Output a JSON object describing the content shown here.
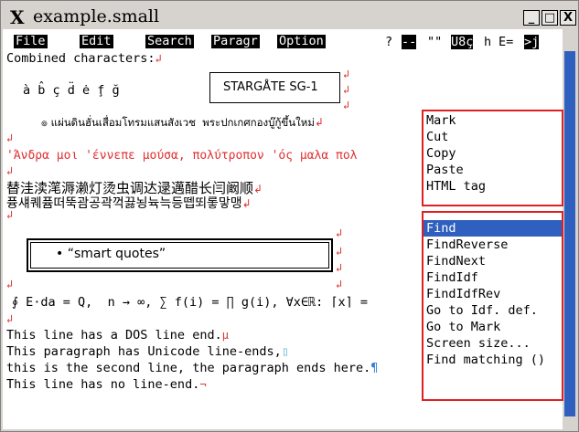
{
  "window": {
    "title": "example.small",
    "x_logo": "X",
    "min": "_",
    "max": "□",
    "close": "X"
  },
  "menubar": {
    "items": [
      "File",
      "Edit",
      "Search",
      "Paragr",
      "Option"
    ],
    "status": {
      "q": "?",
      "dash": "--",
      "quotes": "\"\"",
      "enc": "U8ç",
      "h": "h",
      "e": "E=",
      "end": ">j"
    }
  },
  "lines": {
    "l1": "Combined characters:",
    "l2": "à b̂ ç d̈ ė f̧ ğ",
    "stargate": "STARGÅTE SG-1",
    "thai": "๏ แผ่นดินฮั่นเสื่อมโทรมแสนสังเวช  พระปกเกศกองบู๊กู้ขึ้นใหม่",
    "greek": "'Άνδρα μοι 'έννεπε μούσα, πολύτροπον 'ός μαλα πολ",
    "cjk": "替洼渎滗溽濑灯烫虫调达逯邁醋长闫阚顺",
    "korean": "퓽섀퀘퓸떠뚝괌공곽꺽끓뇡뉵늑등뗍뙤롷맣맹",
    "smart": "• “smart quotes”",
    "math": "∮ E⋅da = Q,  n → ∞, ∑ f(i) = ∏ g(i), ∀x∈ℝ: ⌈x⌉ = ",
    "dos": "This line has a DOS line end.",
    "unicode": "This paragraph has Unicode line-ends,",
    "second": "this is the second line, the paragraph ends here.",
    "noend": "This line has no line-end."
  },
  "marks": {
    "para": "↲",
    "dos": "µ",
    "uni": "▯",
    "pilcrow": "¶",
    "noend": "¬"
  },
  "popup1": [
    "Mark",
    "Cut",
    "Copy",
    "Paste",
    "HTML tag"
  ],
  "popup2": [
    "Find",
    "FindReverse",
    "FindNext",
    "FindIdf",
    "FindIdfRev",
    "Go to Idf. def.",
    "Go to Mark",
    "Screen size...",
    "Find matching ()"
  ],
  "colors": {
    "highlight": "#2f5fbf",
    "popup_border": "#e02020",
    "line_mark": "#e03030"
  }
}
